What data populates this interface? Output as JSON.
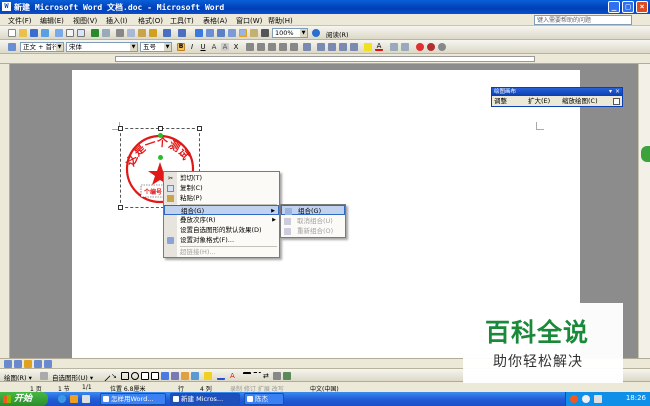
{
  "window": {
    "title": "新建 Microsoft Word 文档.doc - Microsoft Word",
    "icon_letter": "W",
    "minimize": "_",
    "maximize": "□",
    "close": "×"
  },
  "menubar": {
    "items": [
      "文件(F)",
      "编辑(E)",
      "视图(V)",
      "插入(I)",
      "格式(O)",
      "工具(T)",
      "表格(A)",
      "窗口(W)",
      "帮助(H)"
    ],
    "help_placeholder": "键入需要帮助的问题"
  },
  "toolbar": {
    "zoom": "100%",
    "read_label": "阅读(R)"
  },
  "format_toolbar": {
    "style": "正文 + 首行",
    "font": "宋体",
    "size": "五号"
  },
  "float_toolbar": {
    "title": "绘图画布",
    "fit": "调整",
    "expand": "扩大(E)",
    "scale": "缩放绘图(C)"
  },
  "stamp": {
    "ring_text": "这是一个测试",
    "bottom_text": "个编号",
    "color": "#e01818"
  },
  "context_menu": {
    "items": [
      {
        "label": "剪切(T)",
        "icon": "scissors-icon"
      },
      {
        "label": "复制(C)",
        "icon": "copy-icon"
      },
      {
        "label": "粘贴(P)",
        "icon": "paste-icon"
      },
      {
        "label": "组合(G)",
        "icon": "",
        "submenu": true,
        "highlighted": true
      },
      {
        "label": "叠放次序(R)",
        "icon": "",
        "submenu": true
      },
      {
        "label": "设置自选图形的默认效果(D)",
        "icon": ""
      },
      {
        "label": "设置对象格式(F)...",
        "icon": "format-icon"
      },
      {
        "label": "超链接(H)...",
        "icon": "",
        "disabled": true
      }
    ],
    "submenu": [
      {
        "label": "组合(G)",
        "highlighted": true
      },
      {
        "label": "取消组合(U)",
        "disabled": true
      },
      {
        "label": "重新组合(O)",
        "disabled": true
      }
    ]
  },
  "drawbar": {
    "draw_label": "绘图(R) ▾",
    "autoshapes_label": "自选图形(U) ▾"
  },
  "statusbar": {
    "page": "1 页",
    "section": "1 节",
    "page_of": "1/1",
    "position": "位置 6.8厘米",
    "line": "行",
    "col": "4 列",
    "modes": "录制  修订  扩展  改写",
    "lang": "中文(中国)"
  },
  "taskbar": {
    "start": "开始",
    "tasks": [
      "怎样用Word...",
      "新建 Micros...",
      "陈杰"
    ],
    "clock": "18:26"
  },
  "watermark": {
    "big": "百科全说",
    "small": "助你轻松解决"
  },
  "colors": {
    "title_blue": "#0a4fd0",
    "menu_bg": "#ece9d8",
    "highlight": "#c1d2ee",
    "stamp_red": "#e01818",
    "watermark_green": "#1a8a3a"
  }
}
